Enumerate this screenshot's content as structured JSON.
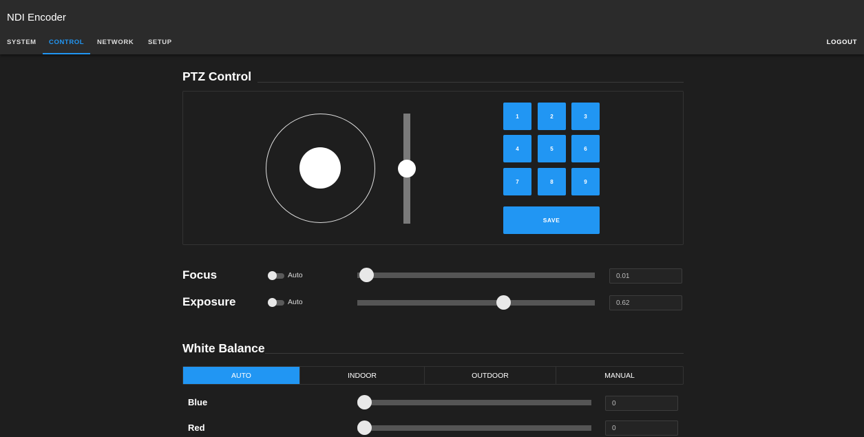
{
  "app": {
    "title": "NDI Encoder"
  },
  "nav": {
    "tabs": [
      {
        "label": "SYSTEM",
        "active": false
      },
      {
        "label": "CONTROL",
        "active": true
      },
      {
        "label": "NETWORK",
        "active": false
      },
      {
        "label": "SETUP",
        "active": false
      }
    ],
    "logout_label": "LOGOUT"
  },
  "ptz": {
    "title": "PTZ Control",
    "presets": [
      "1",
      "2",
      "3",
      "4",
      "5",
      "6",
      "7",
      "8",
      "9"
    ],
    "save_label": "SAVE",
    "zoom_level": 0.5
  },
  "focus": {
    "label": "Focus",
    "auto_label": "Auto",
    "auto_on": false,
    "value": "0.01",
    "level": 0.01
  },
  "exposure": {
    "label": "Exposure",
    "auto_label": "Auto",
    "auto_on": false,
    "value": "0.62",
    "level": 0.62
  },
  "white_balance": {
    "title": "White Balance",
    "modes": [
      {
        "label": "AUTO",
        "active": true
      },
      {
        "label": "INDOOR",
        "active": false
      },
      {
        "label": "OUTDOOR",
        "active": false
      },
      {
        "label": "MANUAL",
        "active": false
      }
    ],
    "blue": {
      "label": "Blue",
      "value": "0",
      "level": 0
    },
    "red": {
      "label": "Red",
      "value": "0",
      "level": 0
    }
  },
  "colors": {
    "accent": "#2196f3",
    "background": "#1e1e1e",
    "appbar": "#2b2b2b"
  }
}
